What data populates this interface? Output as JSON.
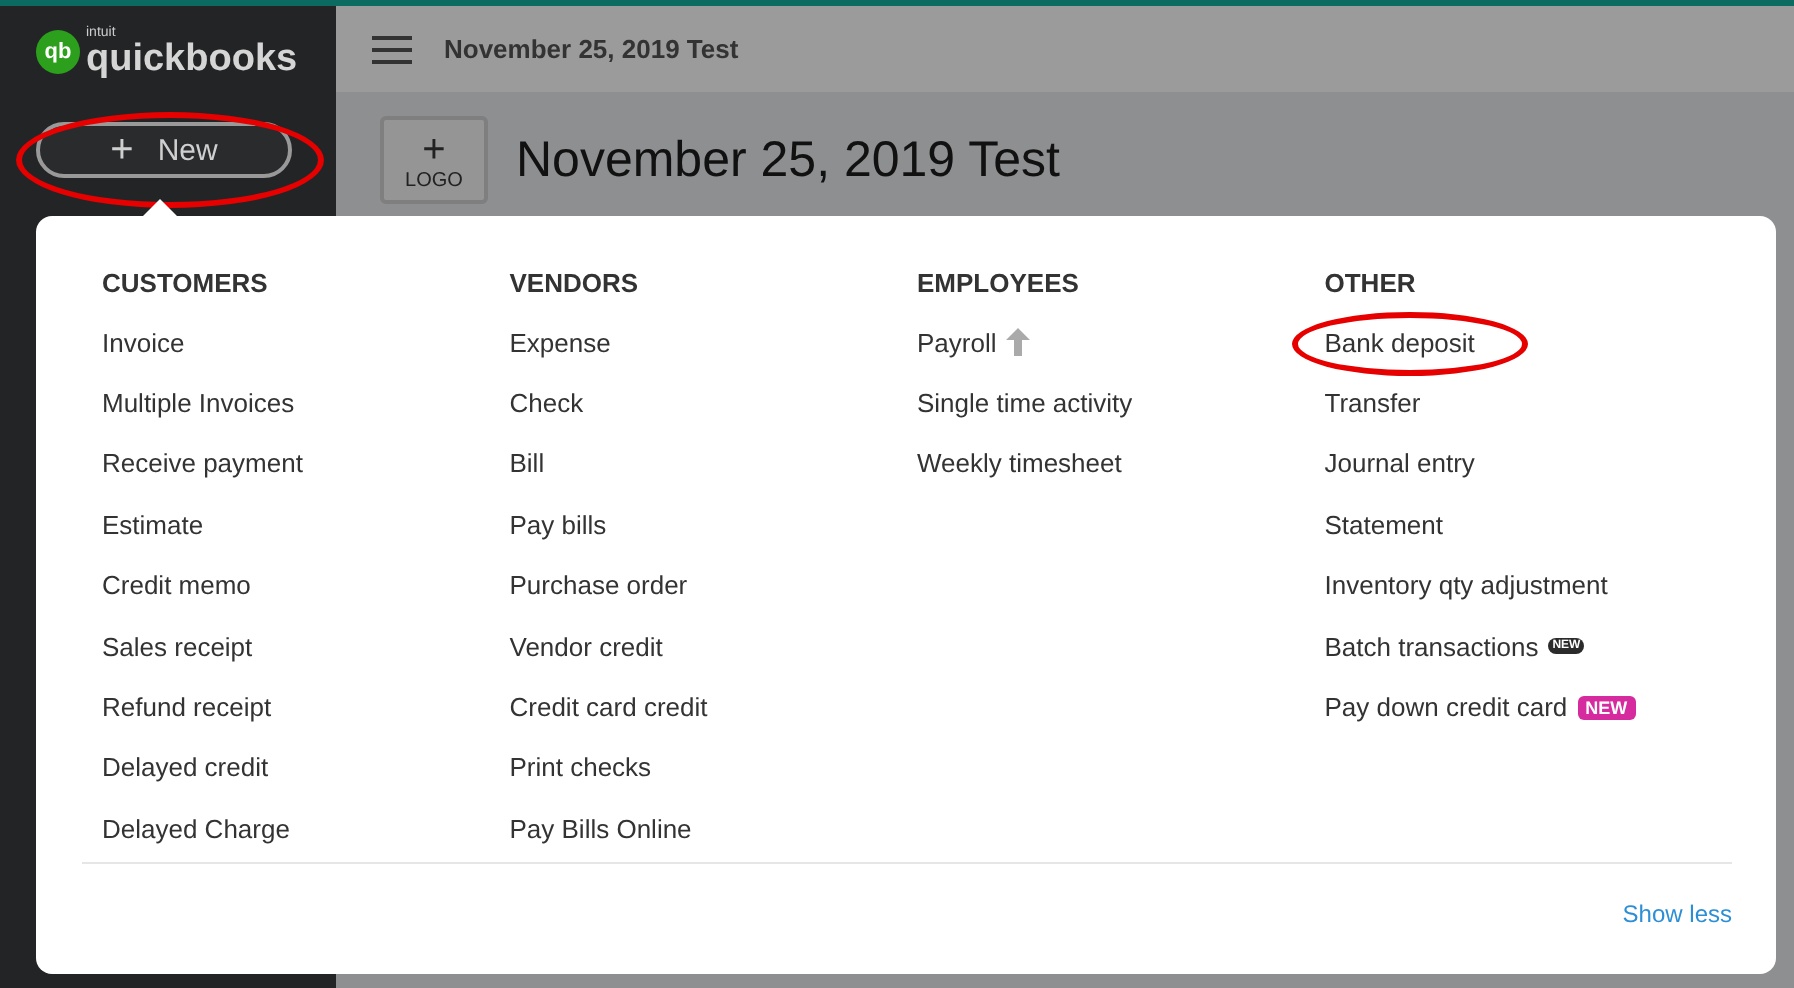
{
  "brand": {
    "small": "intuit",
    "name": "quickbooks",
    "mark": "qb"
  },
  "new_button": {
    "label": "New",
    "icon": "+",
    "circled": true
  },
  "topbar": {
    "company": "November 25, 2019 Test"
  },
  "header": {
    "logo_icon": "+",
    "logo_label": "LOGO",
    "title": "November 25, 2019 Test"
  },
  "menu": {
    "columns": [
      {
        "heading": "CUSTOMERS",
        "items": [
          {
            "label": "Invoice"
          },
          {
            "label": "Multiple Invoices"
          },
          {
            "label": "Receive payment"
          },
          {
            "label": "Estimate"
          },
          {
            "label": "Credit memo"
          },
          {
            "label": "Sales receipt"
          },
          {
            "label": "Refund receipt"
          },
          {
            "label": "Delayed credit"
          },
          {
            "label": "Delayed Charge"
          }
        ]
      },
      {
        "heading": "VENDORS",
        "items": [
          {
            "label": "Expense"
          },
          {
            "label": "Check"
          },
          {
            "label": "Bill"
          },
          {
            "label": "Pay bills"
          },
          {
            "label": "Purchase order"
          },
          {
            "label": "Vendor credit"
          },
          {
            "label": "Credit card credit"
          },
          {
            "label": "Print checks"
          },
          {
            "label": "Pay Bills Online"
          }
        ]
      },
      {
        "heading": "EMPLOYEES",
        "items": [
          {
            "label": "Payroll",
            "upgrade": true
          },
          {
            "label": "Single time activity"
          },
          {
            "label": "Weekly timesheet"
          }
        ]
      },
      {
        "heading": "OTHER",
        "items": [
          {
            "label": "Bank deposit",
            "circled": true
          },
          {
            "label": "Transfer"
          },
          {
            "label": "Journal entry"
          },
          {
            "label": "Statement"
          },
          {
            "label": "Inventory qty adjustment"
          },
          {
            "label": "Batch transactions",
            "badge": {
              "text": "NEW",
              "color": "#2b2b2b"
            }
          },
          {
            "label": "Pay down credit card",
            "badge": {
              "text": "NEW",
              "color": "#d52b9e"
            }
          }
        ]
      }
    ],
    "footer_link": "Show less"
  }
}
